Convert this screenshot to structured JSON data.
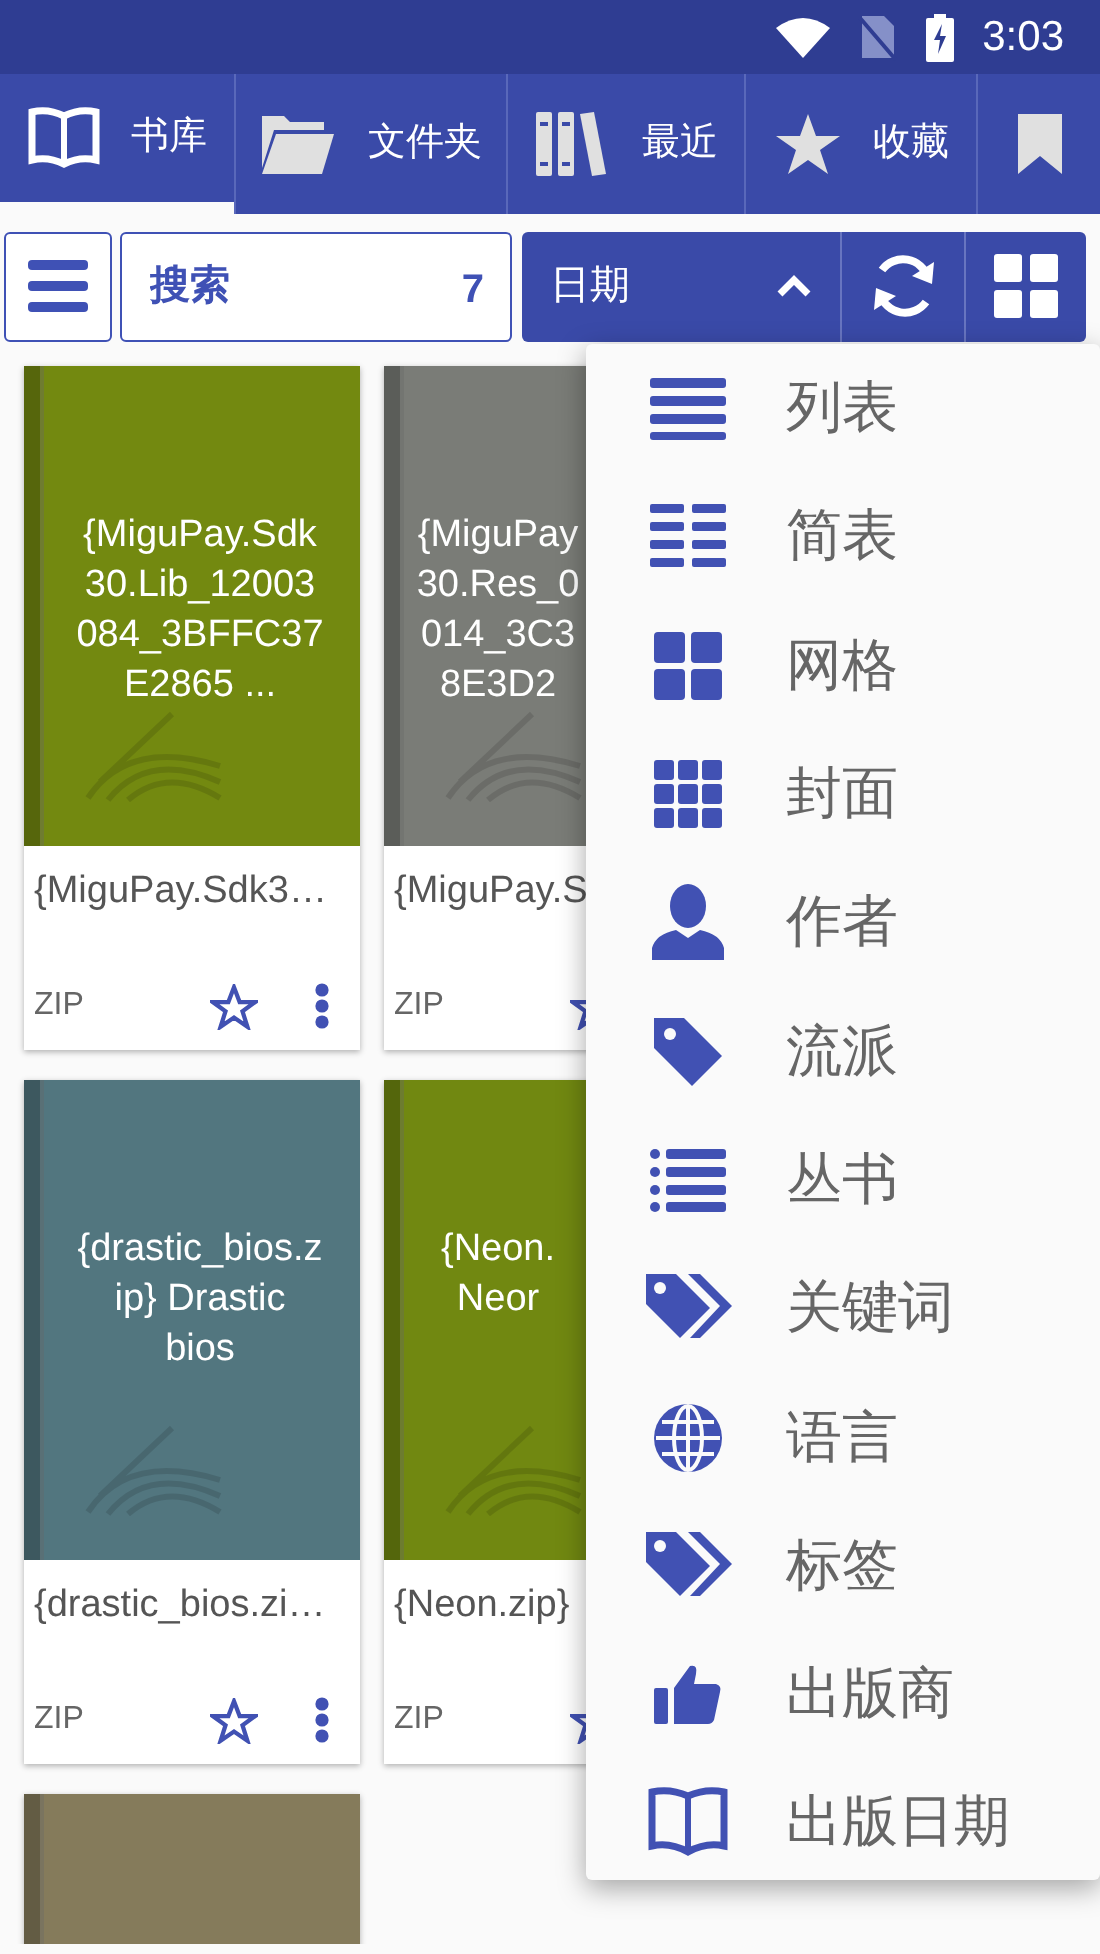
{
  "status_bar": {
    "time": "3:03"
  },
  "tabs": [
    {
      "kind": "book",
      "label": "书库",
      "selected": true
    },
    {
      "kind": "folder",
      "label": "文件夹",
      "selected": false
    },
    {
      "kind": "shelf",
      "label": "最近",
      "selected": false
    },
    {
      "kind": "star",
      "label": "收藏",
      "selected": false
    },
    {
      "kind": "bookmark",
      "selected": false
    }
  ],
  "toolbar": {
    "search": {
      "placeholder": "搜索"
    },
    "count": "7",
    "sort": {
      "label": "日期",
      "expanded": true
    }
  },
  "books": [
    {
      "color": "#738910",
      "cover_lines": [
        "{MiguPay.Sdk",
        "30.Lib_12003",
        "084_3BFFC37",
        "E2865 ..."
      ],
      "title": "{MiguPay.Sdk3…",
      "format": "ZIP",
      "favorite": false
    },
    {
      "color": "#7a7c77",
      "cover_lines": [
        "{MiguPay",
        "30.Res_0",
        "014_3C3",
        "8E3D2"
      ],
      "title": "{MiguPay.S",
      "format": "ZIP",
      "favorite": false
    },
    {
      "color": "#52767f",
      "cover_lines": [
        "{drastic_bios.z",
        "ip} Drastic",
        "bios"
      ],
      "title": "{drastic_bios.zi…",
      "format": "ZIP",
      "favorite": false
    },
    {
      "color": "#718811",
      "cover_lines": [
        "{Neon.",
        "Neor"
      ],
      "title": "{Neon.zip}",
      "format": "ZIP",
      "favorite": false
    },
    {
      "color": "#857b5b"
    }
  ],
  "view_menu": {
    "items": [
      {
        "kind": "list",
        "label": "列表"
      },
      {
        "kind": "compact",
        "label": "简表"
      },
      {
        "kind": "grid",
        "label": "网格"
      },
      {
        "kind": "cover",
        "label": "封面"
      },
      {
        "kind": "person",
        "label": "作者"
      },
      {
        "kind": "tag",
        "label": "流派"
      },
      {
        "kind": "bullets",
        "label": "丛书"
      },
      {
        "kind": "tags",
        "label": "关键词"
      },
      {
        "kind": "globe",
        "label": "语言"
      },
      {
        "kind": "tags",
        "label": "标签"
      },
      {
        "kind": "thumb",
        "label": "出版商"
      },
      {
        "kind": "book",
        "label": "出版日期"
      }
    ]
  }
}
